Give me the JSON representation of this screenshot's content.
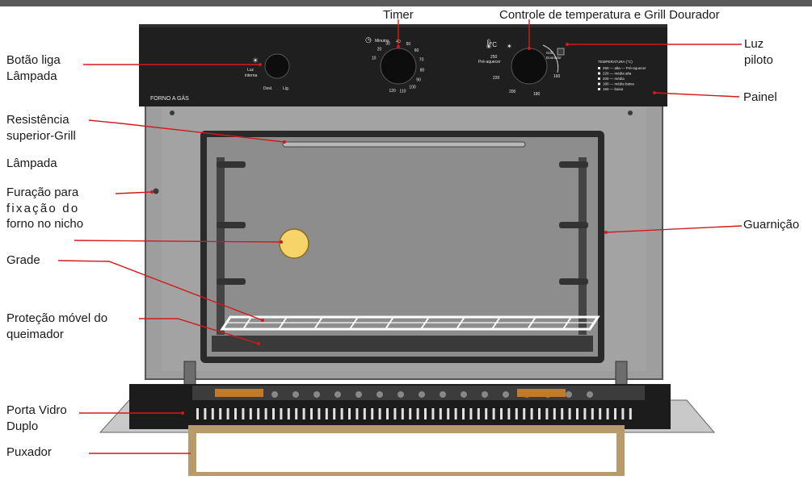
{
  "colors": {
    "leader": "#d31a1a",
    "panel": "#1f1f1f",
    "cabinet": "#9c9c9c",
    "cavity": "#8a8a8a",
    "lamp": "#f7d46a",
    "handle": "#b79b6a",
    "top_bar": "#555555"
  },
  "labels": {
    "timer": "Timer",
    "temp_control": "Controle de temperatura e Grill Dourador",
    "lamp_button_1": "Botão liga",
    "lamp_button_2": "Lâmpada",
    "pilot_1": "Luz",
    "pilot_2": "piloto",
    "panel": "Painel",
    "grill_1": "Resistência",
    "grill_2": "superior-Grill",
    "lamp": "Lâmpada",
    "fixing_1": "Furação para",
    "fixing_2": "fixação do",
    "fixing_3": "forno no nicho",
    "gasket": "Guarnição",
    "rack": "Grade",
    "burner_1": "Proteção móvel do",
    "burner_2": "queimador",
    "door_1": "Porta Vidro",
    "door_2": "Duplo",
    "handle": "Puxador"
  },
  "panel": {
    "brand": "FORNO A GÁS",
    "lamp_knob_top_1": "Luz",
    "lamp_knob_top_2": "interna",
    "lamp_off": "Desl.",
    "lamp_on": "Lig.",
    "timer_header": "Minutos",
    "timer_ticks": [
      "10",
      "20",
      "30",
      "40",
      "50",
      "60",
      "70",
      "80",
      "90",
      "100",
      "110",
      "120"
    ],
    "temp_unit": "°C",
    "temp_marks": [
      "250",
      "Pré-aquecer",
      "220",
      "200",
      "180",
      "160"
    ],
    "grill_text": "Grill",
    "grill_text_2": "Dourador",
    "temp_table_title": "TEMPERATURA (°C)",
    "temp_table": [
      "250 — alta — Pré-aquecer",
      "220 — média alta",
      "200 — média",
      "180 — média baixa",
      "160 — baixa"
    ]
  }
}
